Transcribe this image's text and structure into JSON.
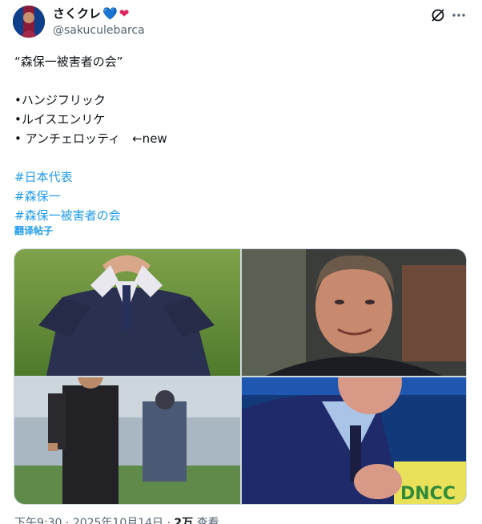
{
  "author": {
    "name": "さくクレ",
    "hearts": [
      "💙",
      "❤"
    ],
    "handle": "@sakuculebarca"
  },
  "header_icons": [
    "grok-icon",
    "more-icon"
  ],
  "tweet": {
    "title_line": "“森保一被害者の会”",
    "items": [
      "•ハンジフリック",
      "•ルイスエンリケ",
      "• アンチェロッティ　←new"
    ],
    "hashtags": [
      "#日本代表",
      "#森保一",
      "#森保一被害者の会"
    ],
    "translate_label": "翻译帖子"
  },
  "media": {
    "images": [
      "man-in-suit-heart-gesture",
      "coach-portrait",
      "coach-on-pitch",
      "man-holding-scarf"
    ]
  },
  "meta": {
    "time": "下午9:30 · 2025年10月14日 · ",
    "views": "2万",
    "views_label": " 查看"
  },
  "colors": {
    "accent": "#1d9bf0",
    "text": "#0f1419",
    "secondary": "#536471",
    "border": "#cfd9de"
  }
}
